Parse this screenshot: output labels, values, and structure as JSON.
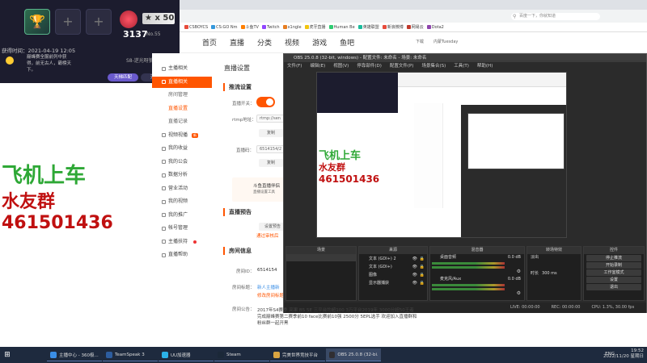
{
  "overlay": {
    "star_level": "★ x 50",
    "score": "3137",
    "rank_no": "No.55",
    "time_label": "获得时间：2021-04-19 12:05",
    "notice": "巅峰赛全服前列中获得，前无古人，霸榜天下。",
    "rank_name": "S8-逆光呀狼",
    "btn_match": "天梯匹配",
    "btn_rank": "天梯榜"
  },
  "promo": {
    "line1": "飞机上车",
    "line2": "水友群",
    "line3": "461501436"
  },
  "browser": {
    "address_placeholder": "百度一下，你就知道",
    "bookmarks": [
      "CSBOYCS",
      "CS:GO Nm",
      "斗鱼TV",
      "Twitch",
      "x1ngle",
      "虎牙直播",
      "Human Be",
      "英雄联盟",
      "新浪微博",
      "网易云",
      "Dota2"
    ],
    "bookmark_colors": [
      "#e74c3c",
      "#3498db",
      "#ff7f00",
      "#9146ff",
      "#e67e22",
      "#f1c40f",
      "#2ecc71",
      "#1abc9c",
      "#e74c3c",
      "#c0392b",
      "#8e44ad"
    ]
  },
  "site_nav": {
    "items": [
      "首页",
      "直播",
      "分类",
      "视频",
      "游戏",
      "鱼吧"
    ],
    "right": [
      "下载",
      "内蒙Tuesday"
    ]
  },
  "sidebar": {
    "items": [
      {
        "label": "主播相关",
        "type": "head"
      },
      {
        "label": "直播相关",
        "type": "live"
      },
      {
        "label": "房间管理",
        "type": "sub"
      },
      {
        "label": "直播设置",
        "type": "sub-sel"
      },
      {
        "label": "直播记录",
        "type": "sub"
      },
      {
        "label": "视频视播",
        "type": "head",
        "tag": "新"
      },
      {
        "label": "我的收益",
        "type": "head"
      },
      {
        "label": "我的公会",
        "type": "head"
      },
      {
        "label": "数据分析",
        "type": "head"
      },
      {
        "label": "营业活动",
        "type": "head"
      },
      {
        "label": "我的视频",
        "type": "head"
      },
      {
        "label": "我的推广",
        "type": "head"
      },
      {
        "label": "帐号管理",
        "type": "head"
      },
      {
        "label": "主播扶持",
        "type": "head",
        "dot": true
      },
      {
        "label": "直播帮助",
        "type": "head"
      }
    ]
  },
  "main": {
    "title": "直播设置",
    "section_push": "推流设置",
    "push_switch_label": "直播开关：",
    "rtmp_label": "rtmp地址：",
    "rtmp_value": "rtmp://sen",
    "copy1": "复制",
    "code_label": "直播码：",
    "code_value": "6514154/2",
    "copy2": "复制",
    "tip_title": "斗鱼直播伴侣",
    "tip_desc": "直播设置工具",
    "section_notice": "直播预告",
    "notice_btn": "设置预告",
    "notice_link": "通过审核后",
    "section_room": "房间信息",
    "room_id_label": "房间ID：",
    "room_id_value": "6514154",
    "room_name_label": "房间标题：",
    "room_name_value": "新人主播新",
    "room_name_link": "修改房间标题",
    "room_notice_label": "房间公告："
  },
  "description": "2017年S4赛季 亮果 B5 5E 三平台均超100 3万平台2019年 3000分超50王者 完成巅峰赛第二赛季前10 face比赛前10强 2500分 5EPL选手 欢迎加入直播群和粉丝群一起开黑",
  "obs": {
    "title": "OBS 25.0.8 (32-bit, windows) - 配置文件: 未命名 - 场景: 未命名",
    "menu": [
      "文件(F)",
      "编辑(E)",
      "视图(V)",
      "停靠部件(D)",
      "配置文件(P)",
      "场景集合(S)",
      "工具(T)",
      "帮助(H)"
    ],
    "docks": {
      "scenes": "场景",
      "sources": "来源",
      "mixer": "混音器",
      "transitions": "转场特效",
      "controls": "控件"
    },
    "sources": [
      "文本 (GDI+) 2",
      "文本 (GDI+)",
      "图像",
      "显示器捕获"
    ],
    "mixer": [
      {
        "name": "桌面音频",
        "db": "0.0 dB"
      },
      {
        "name": "麦克风/Aux",
        "db": "0.0 dB"
      }
    ],
    "transition": "淡出",
    "duration_label": "时长",
    "duration_value": "300 ms",
    "controls": [
      "停止推流",
      "开始录制",
      "工作室模式",
      "设置",
      "退出"
    ],
    "status": [
      "LIVE: 00:00:00",
      "REC: 00:00:00",
      "CPU: 1.3%, 30.00 fps"
    ]
  },
  "taskbar": {
    "tasks": [
      {
        "label": "主播中心 - 360极...",
        "color": "#3a8ee6"
      },
      {
        "label": "TeamSpeak 3",
        "color": "#2d5d9f"
      },
      {
        "label": "UU加速器",
        "color": "#2bb2e8"
      },
      {
        "label": "Steam",
        "color": "#1b2838"
      },
      {
        "label": "完美世界竞技平台",
        "color": "#d9a441"
      },
      {
        "label": "OBS 25.0.8 (32-bi...",
        "color": "#302e31"
      }
    ],
    "lang": "ENG",
    "time": "19:52",
    "date": "2022/11/20 星期日"
  }
}
